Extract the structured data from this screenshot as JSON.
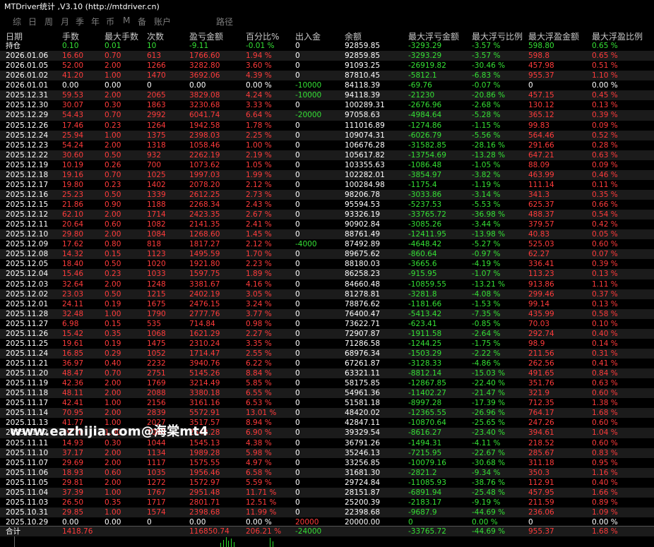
{
  "window": {
    "title": "MTDriver统计 ,V3.10 (http://mtdriver.cn)"
  },
  "tabs": [
    "综",
    "日",
    "周",
    "月",
    "季",
    "年",
    "币",
    "M",
    "备",
    "账户",
    "路径"
  ],
  "headers": [
    "日期",
    "手数",
    "最大手数",
    "次数",
    "盈亏金额",
    "百分比%",
    "出入金",
    "余额",
    "最大浮亏金额",
    "最大浮亏比例",
    "最大浮盈金额",
    "最大浮盈比例"
  ],
  "rows": [
    {
      "date": "持仓",
      "lots": "0.10",
      "maxlots": "0.01",
      "count": "10",
      "pnl": "-9.11",
      "pct": "-0.01 %",
      "inout": "0",
      "balance": "92859.85",
      "mfl": "-3293.29",
      "mflp": "-3.57 %",
      "mfp": "598.80",
      "mfpp": "0.65 %",
      "tone": "green",
      "inoutTone": "white"
    },
    {
      "date": "2026.01.06",
      "lots": "16.60",
      "maxlots": "0.70",
      "count": "613",
      "pnl": "1766.60",
      "pct": "1.94 %",
      "inout": "0",
      "balance": "92859.85",
      "mfl": "-3293.29",
      "mflp": "-3.57 %",
      "mfp": "598.8",
      "mfpp": "0.65 %",
      "tone": "red",
      "inoutTone": "white"
    },
    {
      "date": "2026.01.05",
      "lots": "52.00",
      "maxlots": "2.00",
      "count": "1266",
      "pnl": "3282.80",
      "pct": "3.60 %",
      "inout": "0",
      "balance": "91093.25",
      "mfl": "-26919.82",
      "mflp": "-30.46 %",
      "mfp": "457.98",
      "mfpp": "0.51 %",
      "tone": "red",
      "inoutTone": "white"
    },
    {
      "date": "2026.01.02",
      "lots": "41.20",
      "maxlots": "1.00",
      "count": "1470",
      "pnl": "3692.06",
      "pct": "4.39 %",
      "inout": "0",
      "balance": "87810.45",
      "mfl": "-5812.1",
      "mflp": "-6.83 %",
      "mfp": "955.37",
      "mfpp": "1.10 %",
      "tone": "red",
      "inoutTone": "white"
    },
    {
      "date": "2026.01.01",
      "lots": "0.00",
      "maxlots": "0.00",
      "count": "0",
      "pnl": "0.00",
      "pct": "0.00 %",
      "inout": "-10000",
      "balance": "84118.39",
      "mfl": "-69.76",
      "mflp": "-0.07 %",
      "mfp": "0",
      "mfpp": "0.00 %",
      "tone": "white",
      "inoutTone": "green"
    },
    {
      "date": "2025.12.31",
      "lots": "59.53",
      "maxlots": "2.00",
      "count": "2065",
      "pnl": "3829.08",
      "pct": "4.24 %",
      "inout": "-10000",
      "balance": "94118.39",
      "mfl": "-21230",
      "mflp": "-20.86 %",
      "mfp": "457.15",
      "mfpp": "0.45 %",
      "tone": "red",
      "inoutTone": "green"
    },
    {
      "date": "2025.12.30",
      "lots": "30.07",
      "maxlots": "0.30",
      "count": "1863",
      "pnl": "3230.68",
      "pct": "3.33 %",
      "inout": "0",
      "balance": "100289.31",
      "mfl": "-2676.96",
      "mflp": "-2.68 %",
      "mfp": "130.12",
      "mfpp": "0.13 %",
      "tone": "red",
      "inoutTone": "white"
    },
    {
      "date": "2025.12.29",
      "lots": "54.43",
      "maxlots": "0.70",
      "count": "2992",
      "pnl": "6041.74",
      "pct": "6.64 %",
      "inout": "-20000",
      "balance": "97058.63",
      "mfl": "-4984.64",
      "mflp": "-5.28 %",
      "mfp": "365.12",
      "mfpp": "0.39 %",
      "tone": "red",
      "inoutTone": "green"
    },
    {
      "date": "2025.12.26",
      "lots": "17.46",
      "maxlots": "0.23",
      "count": "1264",
      "pnl": "1942.58",
      "pct": "1.78 %",
      "inout": "0",
      "balance": "111016.89",
      "mfl": "-1274.86",
      "mflp": "-1.15 %",
      "mfp": "99.83",
      "mfpp": "0.09 %",
      "tone": "red",
      "inoutTone": "white"
    },
    {
      "date": "2025.12.24",
      "lots": "25.94",
      "maxlots": "1.00",
      "count": "1375",
      "pnl": "2398.03",
      "pct": "2.25 %",
      "inout": "0",
      "balance": "109074.31",
      "mfl": "-6026.79",
      "mflp": "-5.56 %",
      "mfp": "564.46",
      "mfpp": "0.52 %",
      "tone": "red",
      "inoutTone": "white"
    },
    {
      "date": "2025.12.23",
      "lots": "54.24",
      "maxlots": "2.00",
      "count": "1318",
      "pnl": "1058.46",
      "pct": "1.00 %",
      "inout": "0",
      "balance": "106676.28",
      "mfl": "-31582.85",
      "mflp": "-28.16 %",
      "mfp": "291.66",
      "mfpp": "0.28 %",
      "tone": "red",
      "inoutTone": "white"
    },
    {
      "date": "2025.12.22",
      "lots": "30.60",
      "maxlots": "0.50",
      "count": "932",
      "pnl": "2262.19",
      "pct": "2.19 %",
      "inout": "0",
      "balance": "105617.82",
      "mfl": "-13754.69",
      "mflp": "-13.28 %",
      "mfp": "647.21",
      "mfpp": "0.63 %",
      "tone": "red",
      "inoutTone": "white"
    },
    {
      "date": "2025.12.19",
      "lots": "10.19",
      "maxlots": "0.26",
      "count": "700",
      "pnl": "1073.62",
      "pct": "1.05 %",
      "inout": "0",
      "balance": "103355.63",
      "mfl": "-1086.48",
      "mflp": "-1.05 %",
      "mfp": "88.09",
      "mfpp": "0.09 %",
      "tone": "red",
      "inoutTone": "white"
    },
    {
      "date": "2025.12.18",
      "lots": "19.16",
      "maxlots": "0.70",
      "count": "1025",
      "pnl": "1997.03",
      "pct": "1.99 %",
      "inout": "0",
      "balance": "102282.01",
      "mfl": "-3854.97",
      "mflp": "-3.82 %",
      "mfp": "463.99",
      "mfpp": "0.46 %",
      "tone": "red",
      "inoutTone": "white"
    },
    {
      "date": "2025.12.17",
      "lots": "19.80",
      "maxlots": "0.23",
      "count": "1402",
      "pnl": "2078.20",
      "pct": "2.12 %",
      "inout": "0",
      "balance": "100284.98",
      "mfl": "-1175.4",
      "mflp": "-1.19 %",
      "mfp": "111.14",
      "mfpp": "0.11 %",
      "tone": "red",
      "inoutTone": "white"
    },
    {
      "date": "2025.12.16",
      "lots": "25.23",
      "maxlots": "0.50",
      "count": "1339",
      "pnl": "2612.25",
      "pct": "2.73 %",
      "inout": "0",
      "balance": "98206.78",
      "mfl": "-3033.86",
      "mflp": "-3.14 %",
      "mfp": "341.3",
      "mfpp": "0.35 %",
      "tone": "red",
      "inoutTone": "white"
    },
    {
      "date": "2025.12.15",
      "lots": "21.86",
      "maxlots": "0.90",
      "count": "1188",
      "pnl": "2268.34",
      "pct": "2.43 %",
      "inout": "0",
      "balance": "95594.53",
      "mfl": "-5237.53",
      "mflp": "-5.53 %",
      "mfp": "625.37",
      "mfpp": "0.66 %",
      "tone": "red",
      "inoutTone": "white"
    },
    {
      "date": "2025.12.12",
      "lots": "62.10",
      "maxlots": "2.00",
      "count": "1714",
      "pnl": "2423.35",
      "pct": "2.67 %",
      "inout": "0",
      "balance": "93326.19",
      "mfl": "-33765.72",
      "mflp": "-36.98 %",
      "mfp": "488.37",
      "mfpp": "0.54 %",
      "tone": "red",
      "inoutTone": "white"
    },
    {
      "date": "2025.12.11",
      "lots": "20.64",
      "maxlots": "0.60",
      "count": "1082",
      "pnl": "2141.35",
      "pct": "2.41 %",
      "inout": "0",
      "balance": "90902.84",
      "mfl": "-3085.26",
      "mflp": "-3.44 %",
      "mfp": "379.57",
      "mfpp": "0.42 %",
      "tone": "red",
      "inoutTone": "white"
    },
    {
      "date": "2025.12.10",
      "lots": "29.80",
      "maxlots": "2.00",
      "count": "1084",
      "pnl": "1268.60",
      "pct": "1.45 %",
      "inout": "0",
      "balance": "88761.49",
      "mfl": "-12411.95",
      "mflp": "-13.98 %",
      "mfp": "40.83",
      "mfpp": "0.05 %",
      "tone": "red",
      "inoutTone": "white"
    },
    {
      "date": "2025.12.09",
      "lots": "17.62",
      "maxlots": "0.80",
      "count": "818",
      "pnl": "1817.27",
      "pct": "2.12 %",
      "inout": "-4000",
      "balance": "87492.89",
      "mfl": "-4648.42",
      "mflp": "-5.27 %",
      "mfp": "525.03",
      "mfpp": "0.60 %",
      "tone": "red",
      "inoutTone": "green"
    },
    {
      "date": "2025.12.08",
      "lots": "14.32",
      "maxlots": "0.15",
      "count": "1123",
      "pnl": "1495.59",
      "pct": "1.70 %",
      "inout": "0",
      "balance": "89675.62",
      "mfl": "-860.64",
      "mflp": "-0.97 %",
      "mfp": "62.27",
      "mfpp": "0.07 %",
      "tone": "red",
      "inoutTone": "white"
    },
    {
      "date": "2025.12.05",
      "lots": "18.40",
      "maxlots": "0.50",
      "count": "1020",
      "pnl": "1921.80",
      "pct": "2.23 %",
      "inout": "0",
      "balance": "88180.03",
      "mfl": "-3665.6",
      "mflp": "-4.19 %",
      "mfp": "336.41",
      "mfpp": "0.39 %",
      "tone": "red",
      "inoutTone": "white"
    },
    {
      "date": "2025.12.04",
      "lots": "15.46",
      "maxlots": "0.23",
      "count": "1033",
      "pnl": "1597.75",
      "pct": "1.89 %",
      "inout": "0",
      "balance": "86258.23",
      "mfl": "-915.95",
      "mflp": "-1.07 %",
      "mfp": "113.23",
      "mfpp": "0.13 %",
      "tone": "red",
      "inoutTone": "white"
    },
    {
      "date": "2025.12.03",
      "lots": "32.64",
      "maxlots": "2.00",
      "count": "1248",
      "pnl": "3381.67",
      "pct": "4.16 %",
      "inout": "0",
      "balance": "84660.48",
      "mfl": "-10859.55",
      "mflp": "-13.21 %",
      "mfp": "913.86",
      "mfpp": "1.11 %",
      "tone": "red",
      "inoutTone": "white"
    },
    {
      "date": "2025.12.02",
      "lots": "23.03",
      "maxlots": "0.50",
      "count": "1215",
      "pnl": "2402.19",
      "pct": "3.05 %",
      "inout": "0",
      "balance": "81278.81",
      "mfl": "-3281.8",
      "mflp": "-4.08 %",
      "mfp": "299.46",
      "mfpp": "0.37 %",
      "tone": "red",
      "inoutTone": "white"
    },
    {
      "date": "2025.12.01",
      "lots": "24.11",
      "maxlots": "0.19",
      "count": "1675",
      "pnl": "2476.15",
      "pct": "3.24 %",
      "inout": "0",
      "balance": "78876.62",
      "mfl": "-1181.66",
      "mflp": "-1.53 %",
      "mfp": "99.14",
      "mfpp": "0.13 %",
      "tone": "red",
      "inoutTone": "white"
    },
    {
      "date": "2025.11.28",
      "lots": "32.48",
      "maxlots": "1.00",
      "count": "1790",
      "pnl": "2777.76",
      "pct": "3.77 %",
      "inout": "0",
      "balance": "76400.47",
      "mfl": "-5413.42",
      "mflp": "-7.35 %",
      "mfp": "435.99",
      "mfpp": "0.58 %",
      "tone": "red",
      "inoutTone": "white"
    },
    {
      "date": "2025.11.27",
      "lots": "6.98",
      "maxlots": "0.15",
      "count": "535",
      "pnl": "714.84",
      "pct": "0.98 %",
      "inout": "0",
      "balance": "73622.71",
      "mfl": "-623.41",
      "mflp": "-0.85 %",
      "mfp": "70.03",
      "mfpp": "0.10 %",
      "tone": "red",
      "inoutTone": "white"
    },
    {
      "date": "2025.11.26",
      "lots": "15.42",
      "maxlots": "0.35",
      "count": "1068",
      "pnl": "1621.29",
      "pct": "2.27 %",
      "inout": "0",
      "balance": "72907.87",
      "mfl": "-1911.58",
      "mflp": "-2.64 %",
      "mfp": "292.74",
      "mfpp": "0.40 %",
      "tone": "red",
      "inoutTone": "white"
    },
    {
      "date": "2025.11.25",
      "lots": "19.61",
      "maxlots": "0.19",
      "count": "1475",
      "pnl": "2310.24",
      "pct": "3.35 %",
      "inout": "0",
      "balance": "71286.58",
      "mfl": "-1244.25",
      "mflp": "-1.75 %",
      "mfp": "98.9",
      "mfpp": "0.14 %",
      "tone": "red",
      "inoutTone": "white"
    },
    {
      "date": "2025.11.24",
      "lots": "16.85",
      "maxlots": "0.29",
      "count": "1052",
      "pnl": "1714.47",
      "pct": "2.55 %",
      "inout": "0",
      "balance": "68976.34",
      "mfl": "-1503.29",
      "mflp": "-2.22 %",
      "mfp": "211.56",
      "mfpp": "0.31 %",
      "tone": "red",
      "inoutTone": "white"
    },
    {
      "date": "2025.11.21",
      "lots": "36.97",
      "maxlots": "0.40",
      "count": "2232",
      "pnl": "3940.76",
      "pct": "6.22 %",
      "inout": "0",
      "balance": "67261.87",
      "mfl": "-3128.33",
      "mflp": "-4.86 %",
      "mfp": "262.56",
      "mfpp": "0.41 %",
      "tone": "red",
      "inoutTone": "white"
    },
    {
      "date": "2025.11.20",
      "lots": "48.47",
      "maxlots": "0.70",
      "count": "2751",
      "pnl": "5145.26",
      "pct": "8.84 %",
      "inout": "0",
      "balance": "63321.11",
      "mfl": "-8812.14",
      "mflp": "-15.03 %",
      "mfp": "491.65",
      "mfpp": "0.84 %",
      "tone": "red",
      "inoutTone": "white"
    },
    {
      "date": "2025.11.19",
      "lots": "42.36",
      "maxlots": "2.00",
      "count": "1769",
      "pnl": "3214.49",
      "pct": "5.85 %",
      "inout": "0",
      "balance": "58175.85",
      "mfl": "-12867.85",
      "mflp": "-22.40 %",
      "mfp": "351.76",
      "mfpp": "0.63 %",
      "tone": "red",
      "inoutTone": "white"
    },
    {
      "date": "2025.11.18",
      "lots": "48.11",
      "maxlots": "2.00",
      "count": "2088",
      "pnl": "3380.18",
      "pct": "6.55 %",
      "inout": "0",
      "balance": "54961.36",
      "mfl": "-11402.27",
      "mflp": "-21.47 %",
      "mfp": "321.9",
      "mfpp": "0.60 %",
      "tone": "red",
      "inoutTone": "white"
    },
    {
      "date": "2025.11.17",
      "lots": "42.41",
      "maxlots": "1.00",
      "count": "2156",
      "pnl": "3161.16",
      "pct": "6.53 %",
      "inout": "0",
      "balance": "51581.18",
      "mfl": "-8997.28",
      "mflp": "-17.39 %",
      "mfp": "712.35",
      "mfpp": "1.38 %",
      "tone": "red",
      "inoutTone": "white"
    },
    {
      "date": "2025.11.14",
      "lots": "70.95",
      "maxlots": "2.00",
      "count": "2839",
      "pnl": "5572.91",
      "pct": "13.01 %",
      "inout": "0",
      "balance": "48420.02",
      "mfl": "-12365.55",
      "mflp": "-26.96 %",
      "mfp": "764.17",
      "mfpp": "1.68 %",
      "tone": "red",
      "inoutTone": "white"
    },
    {
      "date": "2025.11.13",
      "lots": "41.77",
      "maxlots": "1.00",
      "count": "2027",
      "pnl": "3517.57",
      "pct": "8.94 %",
      "inout": "0",
      "balance": "42847.11",
      "mfl": "-10870.64",
      "mflp": "-25.65 %",
      "mfp": "247.26",
      "mfpp": "0.60 %",
      "tone": "red",
      "inoutTone": "white"
    },
    {
      "date": "2025.11.12",
      "lots": "39.70",
      "maxlots": "1.00",
      "count": "2082",
      "pnl": "2542.28",
      "pct": "6.90 %",
      "inout": "0",
      "balance": "39329.54",
      "mfl": "-8616.27",
      "mflp": "-23.40 %",
      "mfp": "394.61",
      "mfpp": "1.04 %",
      "tone": "red",
      "inoutTone": "white"
    },
    {
      "date": "2025.11.11",
      "lots": "14.93",
      "maxlots": "0.30",
      "count": "1044",
      "pnl": "1545.13",
      "pct": "4.38 %",
      "inout": "0",
      "balance": "36791.26",
      "mfl": "-1494.31",
      "mflp": "-4.11 %",
      "mfp": "218.52",
      "mfpp": "0.60 %",
      "tone": "red",
      "inoutTone": "white"
    },
    {
      "date": "2025.11.10",
      "lots": "37.17",
      "maxlots": "2.00",
      "count": "1134",
      "pnl": "1989.28",
      "pct": "5.98 %",
      "inout": "0",
      "balance": "35246.13",
      "mfl": "-7215.95",
      "mflp": "-22.67 %",
      "mfp": "285.67",
      "mfpp": "0.83 %",
      "tone": "red",
      "inoutTone": "white"
    },
    {
      "date": "2025.11.07",
      "lots": "29.69",
      "maxlots": "2.00",
      "count": "1117",
      "pnl": "1575.55",
      "pct": "4.97 %",
      "inout": "0",
      "balance": "33256.85",
      "mfl": "-10079.16",
      "mflp": "-30.68 %",
      "mfp": "311.18",
      "mfpp": "0.95 %",
      "tone": "red",
      "inoutTone": "white"
    },
    {
      "date": "2025.11.06",
      "lots": "18.93",
      "maxlots": "0.60",
      "count": "1035",
      "pnl": "1956.46",
      "pct": "6.58 %",
      "inout": "0",
      "balance": "31681.30",
      "mfl": "-2821.2",
      "mflp": "-9.34 %",
      "mfp": "350.3",
      "mfpp": "1.16 %",
      "tone": "red",
      "inoutTone": "white"
    },
    {
      "date": "2025.11.05",
      "lots": "29.81",
      "maxlots": "2.00",
      "count": "1272",
      "pnl": "1572.97",
      "pct": "5.59 %",
      "inout": "0",
      "balance": "29724.84",
      "mfl": "-11085.93",
      "mflp": "-38.76 %",
      "mfp": "112.91",
      "mfpp": "0.40 %",
      "tone": "red",
      "inoutTone": "white"
    },
    {
      "date": "2025.11.04",
      "lots": "37.39",
      "maxlots": "1.00",
      "count": "1767",
      "pnl": "2951.48",
      "pct": "11.71 %",
      "inout": "0",
      "balance": "28151.87",
      "mfl": "-6891.94",
      "mflp": "-25.48 %",
      "mfp": "457.95",
      "mfpp": "1.66 %",
      "tone": "red",
      "inoutTone": "white"
    },
    {
      "date": "2025.11.03",
      "lots": "26.50",
      "maxlots": "0.35",
      "count": "1717",
      "pnl": "2801.71",
      "pct": "12.51 %",
      "inout": "0",
      "balance": "25200.39",
      "mfl": "-2183.17",
      "mflp": "-9.19 %",
      "mfp": "211.59",
      "mfpp": "0.89 %",
      "tone": "red",
      "inoutTone": "white"
    },
    {
      "date": "2025.10.31",
      "lots": "29.85",
      "maxlots": "1.00",
      "count": "1574",
      "pnl": "2398.68",
      "pct": "11.99 %",
      "inout": "0",
      "balance": "22398.68",
      "mfl": "-9687.9",
      "mflp": "-44.69 %",
      "mfp": "236.06",
      "mfpp": "1.09 %",
      "tone": "red",
      "inoutTone": "white"
    },
    {
      "date": "2025.10.29",
      "lots": "0.00",
      "maxlots": "0.00",
      "count": "0",
      "pnl": "0.00",
      "pct": "0.00 %",
      "inout": "20000",
      "balance": "20000.00",
      "mfl": "0",
      "mflp": "0.00 %",
      "mfp": "0",
      "mfpp": "0.00 %",
      "tone": "white",
      "inoutTone": "red"
    }
  ],
  "total": {
    "date": "合计",
    "lots": "1418.76",
    "maxlots": "",
    "count": "",
    "pnl": "116850.74",
    "pct": "206.21 %",
    "inout": "-24000",
    "balance": "",
    "mfl": "-33765.72",
    "mflp": "-44.69 %",
    "mfp": "955.37",
    "mfpp": "1.68 %"
  },
  "watermark": "www.eazhijia.com@海棠mt4",
  "colors": {
    "red": "#ff3b3b",
    "green": "#35e035",
    "white": "#ffffff",
    "header": "#c8c8c8"
  }
}
